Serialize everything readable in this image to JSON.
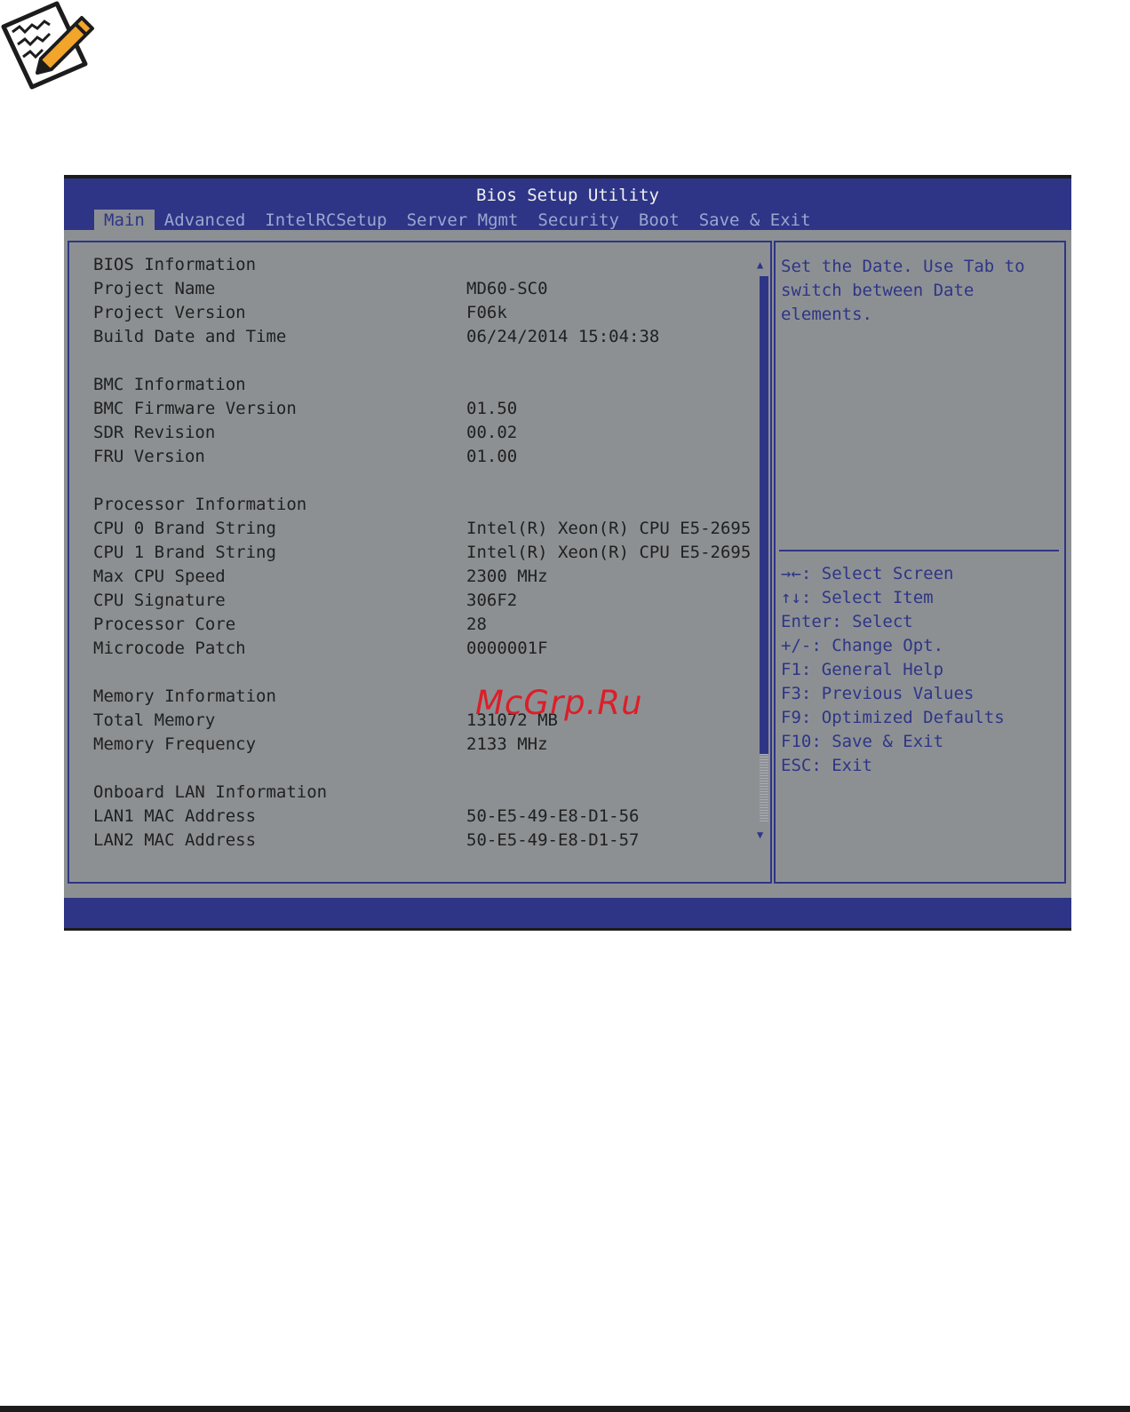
{
  "bios": {
    "title": "Bios Setup Utility",
    "tabs": [
      "Main",
      "Advanced",
      "IntelRCSetup",
      "Server Mgmt",
      "Security",
      "Boot",
      "Save & Exit"
    ],
    "active_tab": "Main",
    "info": {
      "bios_header": "BIOS Information",
      "project_name_label": "Project Name",
      "project_name_value": "MD60-SC0",
      "project_version_label": "Project Version",
      "project_version_value": "F06k",
      "build_date_label": "Build Date and Time",
      "build_date_value": "06/24/2014 15:04:38",
      "bmc_header": "BMC Information",
      "bmc_fw_label": "BMC Firmware Version",
      "bmc_fw_value": "01.50",
      "sdr_label": "SDR Revision",
      "sdr_value": "00.02",
      "fru_label": "FRU Version",
      "fru_value": "01.00",
      "proc_header": "Processor Information",
      "cpu0_label": "CPU 0 Brand String",
      "cpu0_value": "Intel(R) Xeon(R) CPU E5-2695",
      "cpu1_label": "CPU 1 Brand String",
      "cpu1_value": "Intel(R) Xeon(R) CPU E5-2695",
      "max_cpu_label": "Max CPU Speed",
      "max_cpu_value": "2300 MHz",
      "cpu_sig_label": "CPU Signature",
      "cpu_sig_value": "306F2",
      "proc_core_label": "Processor Core",
      "proc_core_value": "28",
      "microcode_label": "Microcode Patch",
      "microcode_value": "0000001F",
      "mem_header": "Memory Information",
      "total_mem_label": "Total Memory",
      "total_mem_value": "131072 MB",
      "mem_freq_label": "Memory Frequency",
      "mem_freq_value": "2133 MHz",
      "lan_header": "Onboard LAN Information",
      "lan1_label": "LAN1 MAC Address",
      "lan1_value": "50-E5-49-E8-D1-56",
      "lan2_label": "LAN2 MAC Address",
      "lan2_value": "50-E5-49-E8-D1-57"
    },
    "help_text": "Set the Date. Use Tab to switch between Date elements.",
    "keys": {
      "select_screen": "→←: Select Screen",
      "select_item": "↑↓: Select Item",
      "enter": "Enter: Select",
      "change": "+/-: Change Opt.",
      "f1": "F1: General Help",
      "f3": "F3: Previous Values",
      "f9": "F9: Optimized Defaults",
      "f10": "F10: Save & Exit",
      "esc": "ESC: Exit"
    },
    "scroll_up": "▲",
    "scroll_down": "▼"
  },
  "watermark": "McGrp.Ru",
  "colors": {
    "bios_blue": "#2e3586",
    "panel_gray": "#8d9093",
    "watermark_red": "#dc1e28"
  },
  "icons": {
    "note": "note-pencil-icon"
  }
}
